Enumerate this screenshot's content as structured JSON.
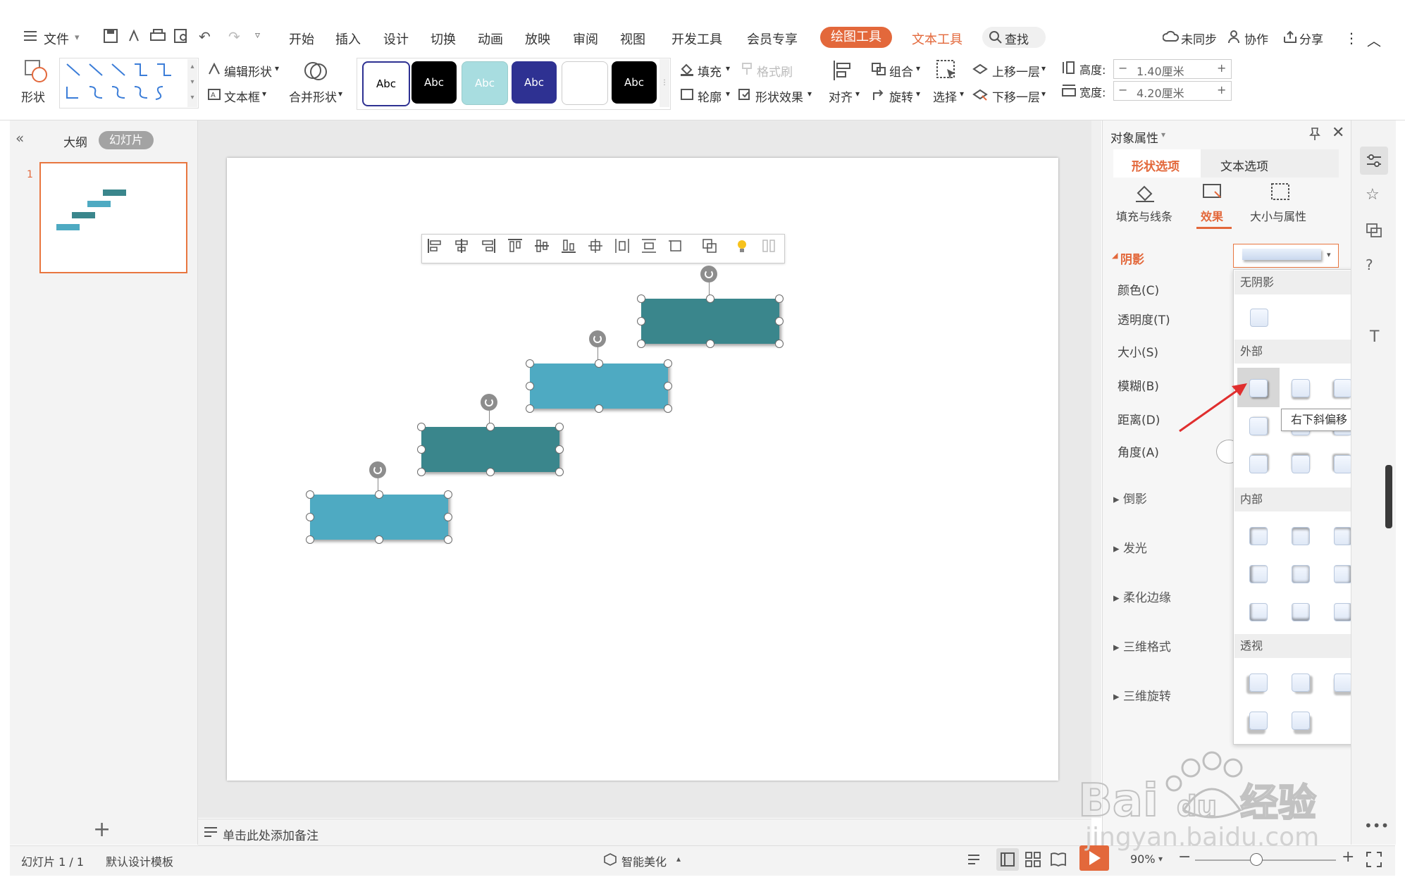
{
  "menu": {
    "file_label": "文件",
    "tabs": [
      "开始",
      "插入",
      "设计",
      "切换",
      "动画",
      "放映",
      "审阅",
      "视图",
      "开发工具",
      "会员专享"
    ],
    "drawing_tools": "绘图工具",
    "text_tools": "文本工具",
    "search": "查找",
    "sync": "未同步",
    "collab": "协作",
    "share": "分享"
  },
  "ribbon": {
    "shape": "形状",
    "edit_shape": "编辑形状",
    "text_box": "文本框",
    "merge_shapes": "合并形状",
    "style_samples": [
      "Abc",
      "Abc",
      "Abc",
      "Abc",
      "",
      "Abc"
    ],
    "fill": "填充",
    "format_painter": "格式刷",
    "outline": "轮廓",
    "shape_effects": "形状效果",
    "align": "对齐",
    "group": "组合",
    "rotate": "旋转",
    "select": "选择",
    "bring_forward": "上移一层",
    "send_backward": "下移一层",
    "height_label": "高度:",
    "height_value": "1.40厘米",
    "width_label": "宽度:",
    "width_value": "4.20厘米"
  },
  "left_pane": {
    "outline_tab": "大纲",
    "slides_tab": "幻灯片",
    "slide_number": "1"
  },
  "notes_placeholder": "单击此处添加备注",
  "status": {
    "slide_info": "幻灯片 1 / 1",
    "template": "默认设计模板",
    "smart_beautify": "智能美化",
    "zoom": "90%"
  },
  "panel": {
    "title": "对象属性",
    "tab_shape": "形状选项",
    "tab_text": "文本选项",
    "sub_fill": "填充与线条",
    "sub_effect": "效果",
    "sub_size": "大小与属性",
    "shadow_section": "阴影",
    "props": [
      "颜色(C)",
      "透明度(T)",
      "大小(S)",
      "模糊(B)",
      "距离(D)",
      "角度(A)"
    ],
    "collapsed": [
      "倒影",
      "发光",
      "柔化边缘",
      "三维格式",
      "三维旋转"
    ]
  },
  "dropdown": {
    "no_shadow": "无阴影",
    "outer": "外部",
    "inner": "内部",
    "perspective": "透视",
    "tooltip": "右下斜偏移"
  },
  "watermark": "Baidu 经验 jingyan.baidu.com",
  "colors": {
    "accent_orange": "#e3683b",
    "teal_dark": "#3a868c",
    "teal_light": "#4eaac2",
    "selection_orange": "#e8763f"
  }
}
